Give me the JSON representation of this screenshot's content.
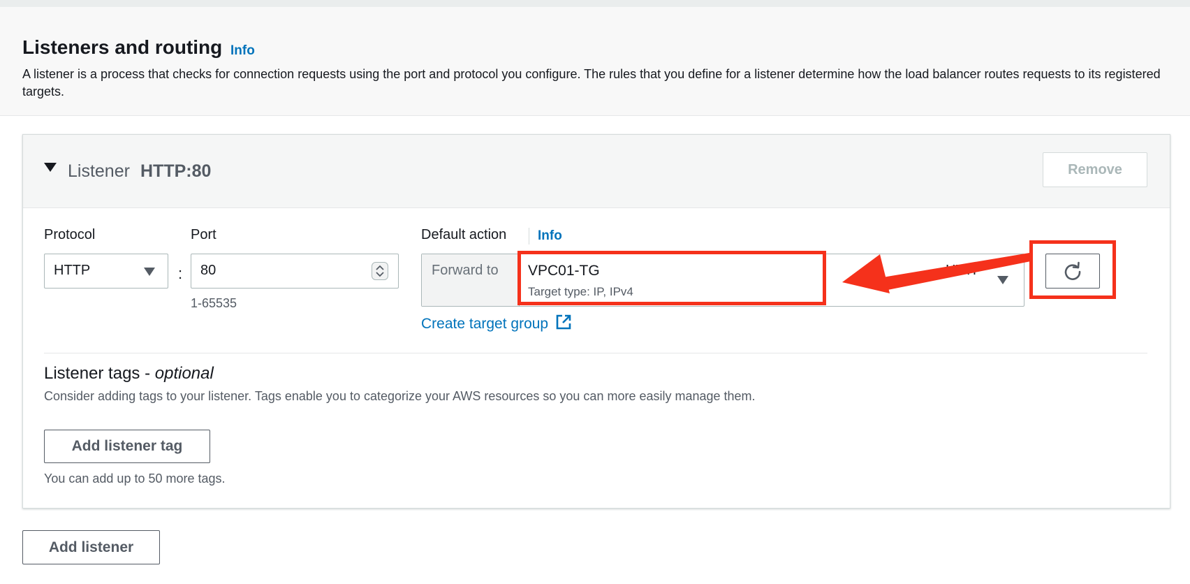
{
  "section": {
    "title": "Listeners and routing",
    "info_label": "Info",
    "description": "A listener is a process that checks for connection requests using the port and protocol you configure. The rules that you define for a listener determine how the load balancer routes requests to its registered targets."
  },
  "listener": {
    "word": "Listener",
    "id": "HTTP:80",
    "remove_label": "Remove",
    "protocol": {
      "label": "Protocol",
      "value": "HTTP"
    },
    "colon": ":",
    "port": {
      "label": "Port",
      "value": "80",
      "hint": "1-65535"
    },
    "default_action": {
      "label": "Default action",
      "info_label": "Info",
      "forward_label": "Forward to",
      "target_group_name": "VPC01-TG",
      "target_group_type": "Target type: IP, IPv4",
      "target_group_protocol": "HTTP",
      "create_link_label": "Create target group"
    },
    "tags": {
      "title": "Listener tags - ",
      "title_optional": "optional",
      "description": "Consider adding tags to your listener. Tags enable you to categorize your AWS resources so you can more easily manage them.",
      "add_button_label": "Add listener tag",
      "limit_text": "You can add up to 50 more tags."
    }
  },
  "add_listener_label": "Add listener",
  "icons": {
    "collapse": "caret-down-icon",
    "protocol_dropdown": "dropdown-arrow-icon",
    "port_stepper": "stepper-icon",
    "target_dropdown": "dropdown-arrow-icon",
    "refresh": "refresh-icon",
    "external_link": "external-link-icon"
  },
  "colors": {
    "link": "#0073bb",
    "annotation": "#f5311b",
    "text": "#16191f",
    "secondary_text": "#545b64"
  }
}
